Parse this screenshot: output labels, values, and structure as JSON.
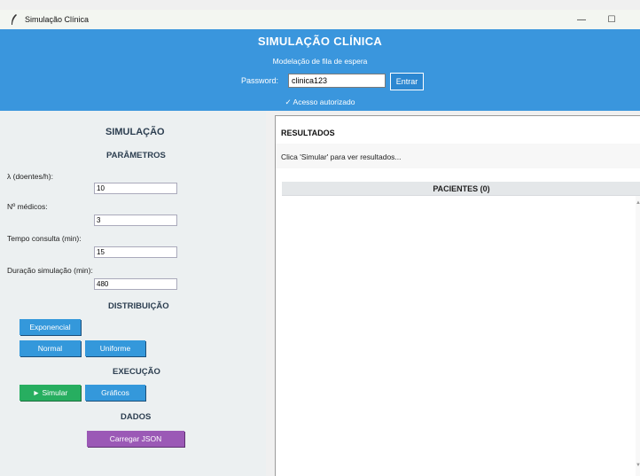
{
  "window": {
    "title": "Simulação Clínica",
    "minimize_glyph": "—",
    "maximize_glyph": "☐",
    "app_icon": "feather-icon"
  },
  "header": {
    "title": "SIMULAÇÃO CLÍNICA",
    "subtitle": "Modelação de fila de espera",
    "password_label": "Password:",
    "password_value": "clinica123",
    "enter_label": "Entrar",
    "auth_status": "✓ Acesso autorizado",
    "bg_color": "#3a96dd"
  },
  "left": {
    "title": "SIMULAÇÃO",
    "params_title": "PARÂMETROS",
    "fields": [
      {
        "label": "λ (doentes/h):",
        "value": "10"
      },
      {
        "label": "Nº médicos:",
        "value": "3"
      },
      {
        "label": "Tempo consulta (min):",
        "value": "15"
      },
      {
        "label": "Duração simulação (min):",
        "value": "480"
      }
    ],
    "dist_title": "DISTRIBUIÇÃO",
    "dist_buttons": [
      "Exponencial",
      "Normal",
      "Uniforme"
    ],
    "exec_title": "EXECUÇÃO",
    "simulate_label": "► Simular",
    "charts_label": "Gráficos",
    "data_title": "DADOS",
    "load_json_label": "Carregar JSON"
  },
  "right": {
    "results_title": "RESULTADOS",
    "results_hint": "Clica 'Simular' para ver resultados...",
    "patients_header": "PACIENTES (0)"
  },
  "colors": {
    "blue_button": "#3498db",
    "green_button": "#27ae60",
    "purple_button": "#9b59b6",
    "panel_bg": "#ecf0f1"
  }
}
